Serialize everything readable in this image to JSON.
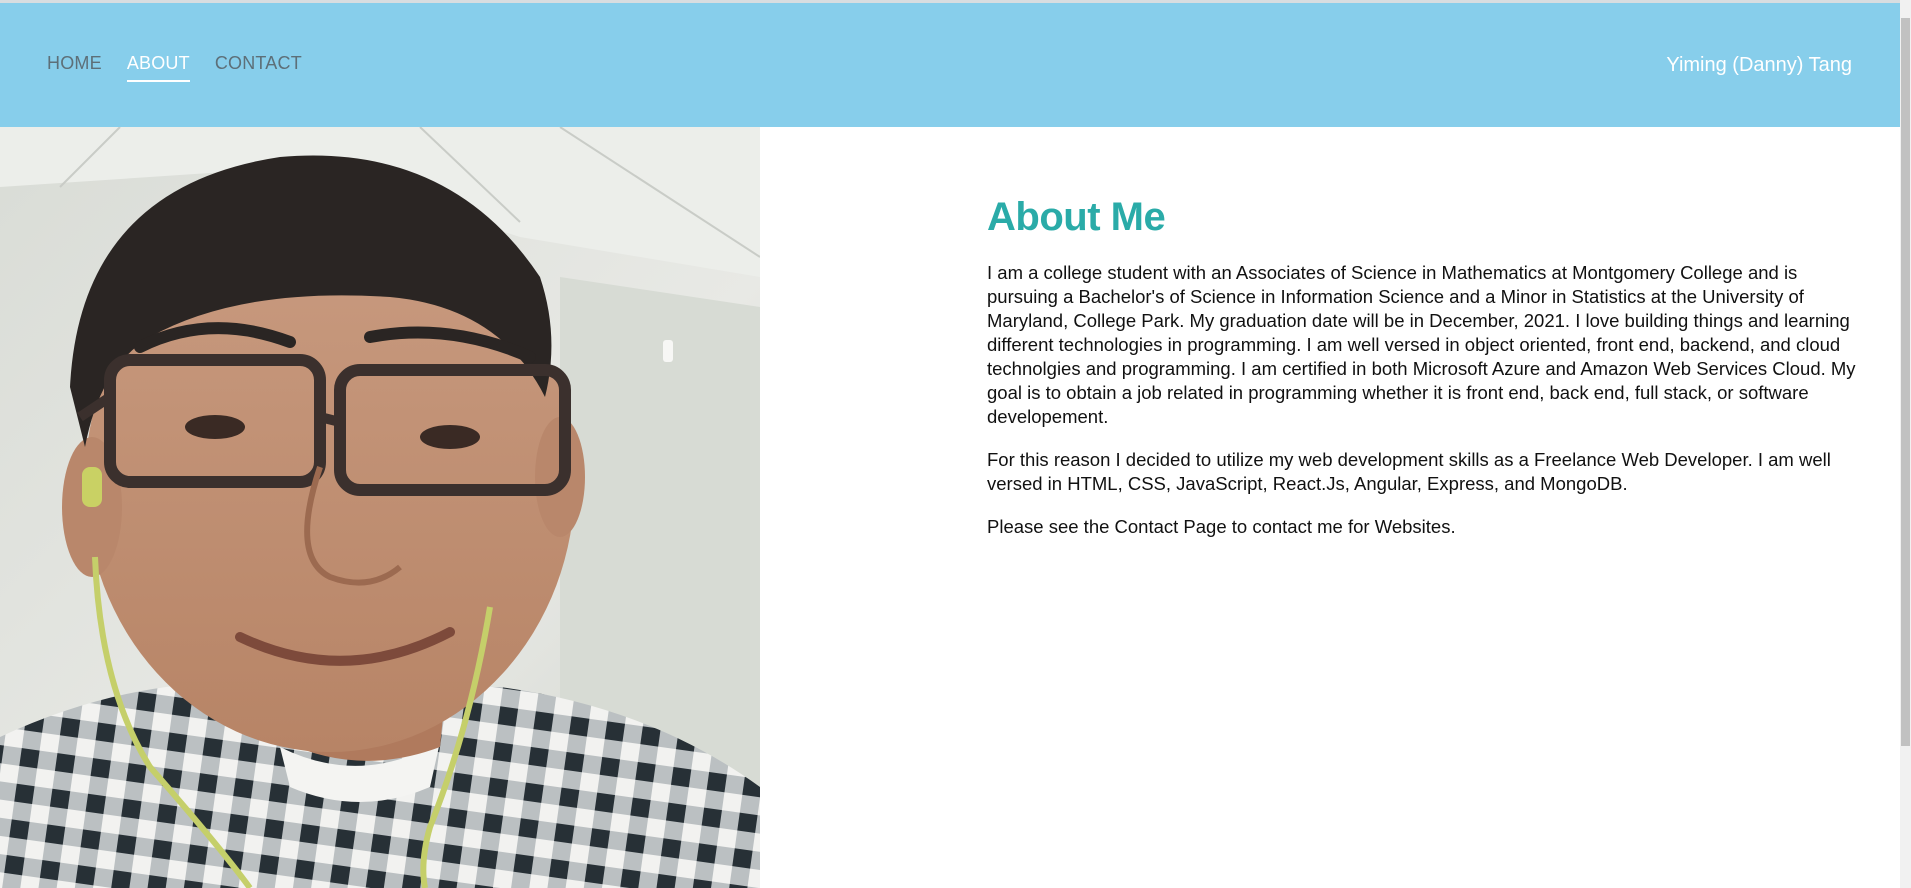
{
  "nav": {
    "items": [
      {
        "label": "HOME",
        "active": false
      },
      {
        "label": "ABOUT",
        "active": true
      },
      {
        "label": "CONTACT",
        "active": false
      }
    ],
    "brand": "Yiming (Danny) Tang"
  },
  "main": {
    "title": "About Me",
    "paragraphs": [
      "I am a college student with an Associates of Science in Mathematics at Montgomery College and is pursuing a Bachelor's of Science in Information Science and a Minor in Statistics at the University of Maryland, College Park. My graduation date will be in December, 2021. I love building things and learning different technologies in programming. I am well versed in object oriented, front end, backend, and cloud technolgies and programming. I am certified in both Microsoft Azure and Amazon Web Services Cloud. My goal is to obtain a job related in programming whether it is front end, back end, full stack, or software developement.",
      "For this reason I decided to utilize my web development skills as a Freelance Web Developer. I am well versed in HTML, CSS, JavaScript, React.Js, Angular, Express, and MongoDB.",
      "Please see the Contact Page to contact me for Websites."
    ]
  },
  "colors": {
    "navbar": "#87ceeb",
    "title": "#2aaba8",
    "nav_active": "#ffffff",
    "nav_inactive": "#5d6f78"
  }
}
